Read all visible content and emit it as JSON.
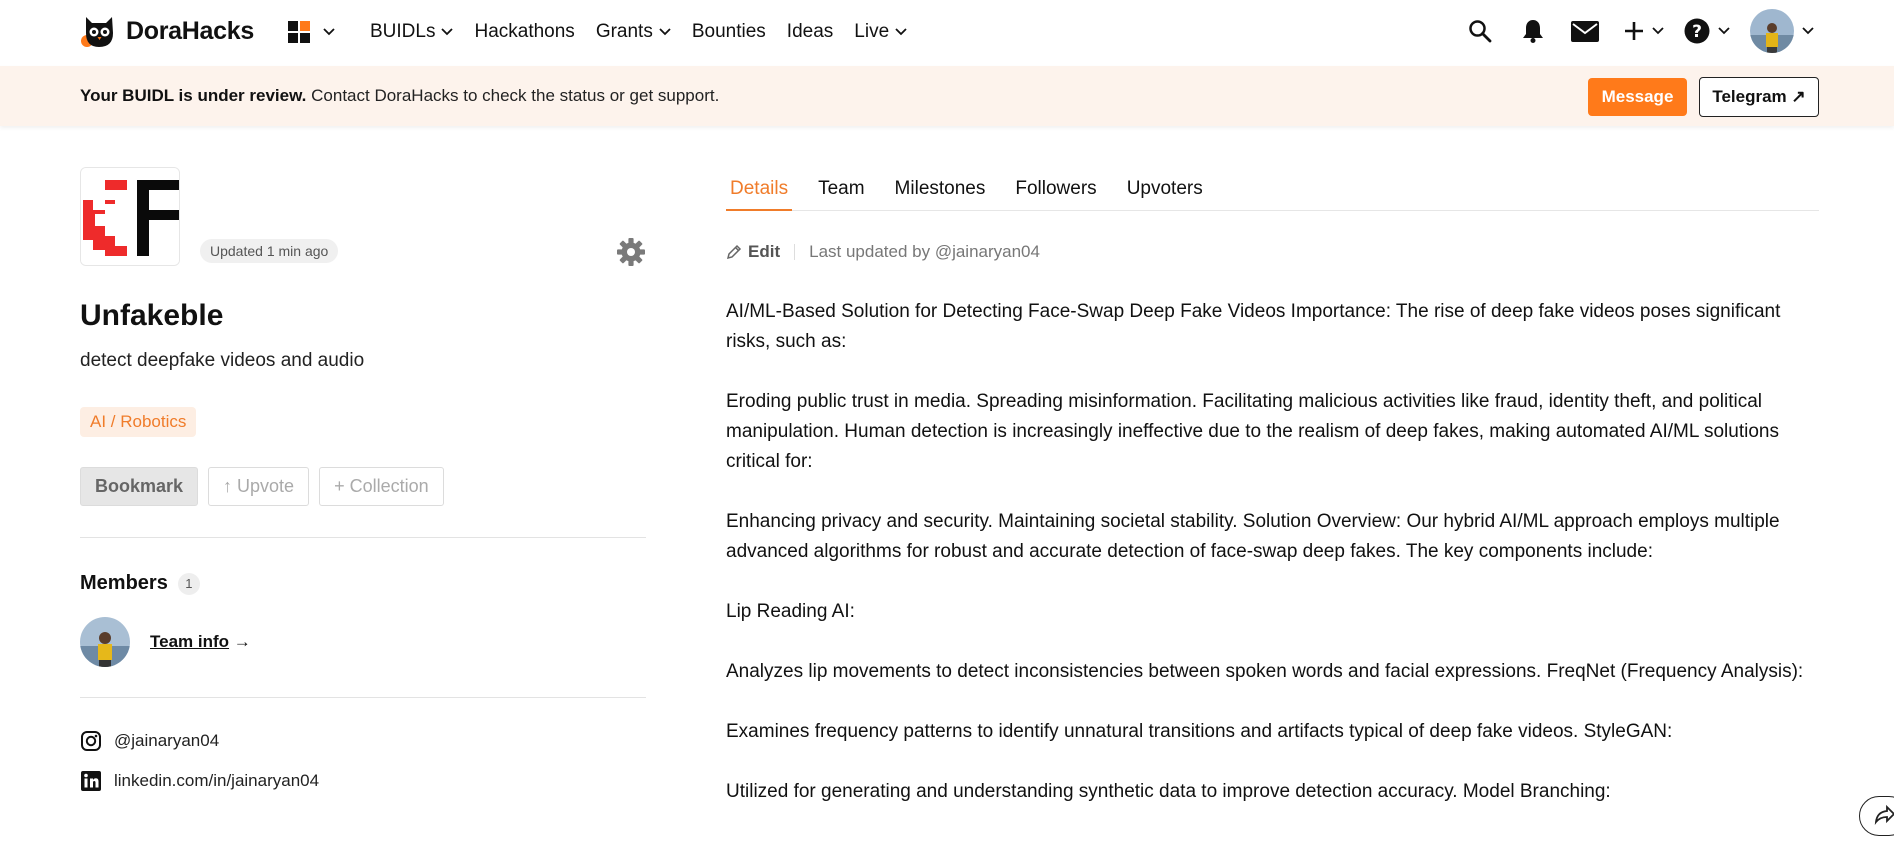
{
  "brand": {
    "name": "DoraHacks"
  },
  "nav": {
    "items": [
      {
        "label": "BUIDLs",
        "dropdown": true
      },
      {
        "label": "Hackathons",
        "dropdown": false
      },
      {
        "label": "Grants",
        "dropdown": true
      },
      {
        "label": "Bounties",
        "dropdown": false
      },
      {
        "label": "Ideas",
        "dropdown": false
      },
      {
        "label": "Live",
        "dropdown": true
      }
    ],
    "right_icons": [
      "search-icon",
      "bell-icon",
      "mail-icon",
      "plus-icon",
      "help-icon",
      "avatar"
    ]
  },
  "banner": {
    "bold": "Your BUIDL is under review.",
    "text": " Contact DoraHacks to check the status or get support.",
    "message_label": "Message",
    "telegram_label": "Telegram ↗"
  },
  "project": {
    "updated": "Updated 1 min ago",
    "name": "Unfakeble",
    "tagline": "detect deepfake videos and audio",
    "tag": "AI / Robotics",
    "bookmark_label": "Bookmark",
    "upvote_label": "↑ Upvote",
    "collection_label": "+ Collection"
  },
  "members": {
    "title": "Members",
    "count": "1",
    "team_info_label": "Team info",
    "team_info_arrow": " →"
  },
  "social": {
    "instagram": "@jainaryan04",
    "linkedin": "linkedin.com/in/jainaryan04"
  },
  "tabs": [
    "Details",
    "Team",
    "Milestones",
    "Followers",
    "Upvoters"
  ],
  "edit": {
    "label": "Edit",
    "last_updated": "Last updated by @jainaryan04"
  },
  "content": {
    "paragraphs": [
      "AI/ML-Based Solution for Detecting Face-Swap Deep Fake Videos Importance: The rise of deep fake videos poses significant risks, such as:",
      "Eroding public trust in media. Spreading misinformation. Facilitating malicious activities like fraud, identity theft, and political manipulation. Human detection is increasingly ineffective due to the realism of deep fakes, making automated AI/ML solutions critical for:",
      "Enhancing privacy and security. Maintaining societal stability. Solution Overview: Our hybrid AI/ML approach employs multiple advanced algorithms for robust and accurate detection of face-swap deep fakes. The key components include:",
      "Lip Reading AI:",
      "Analyzes lip movements to detect inconsistencies between spoken words and facial expressions. FreqNet (Frequency Analysis):",
      "Examines frequency patterns to identify unnatural transitions and artifacts typical of deep fake videos. StyleGAN:",
      "Utilized for generating and understanding synthetic data to improve detection accuracy. Model Branching:"
    ]
  },
  "colors": {
    "accent": "#ff7a1a",
    "tab_active": "#f07c2a",
    "banner_bg": "#fdf3ec",
    "tag_bg": "#fdeee3"
  }
}
